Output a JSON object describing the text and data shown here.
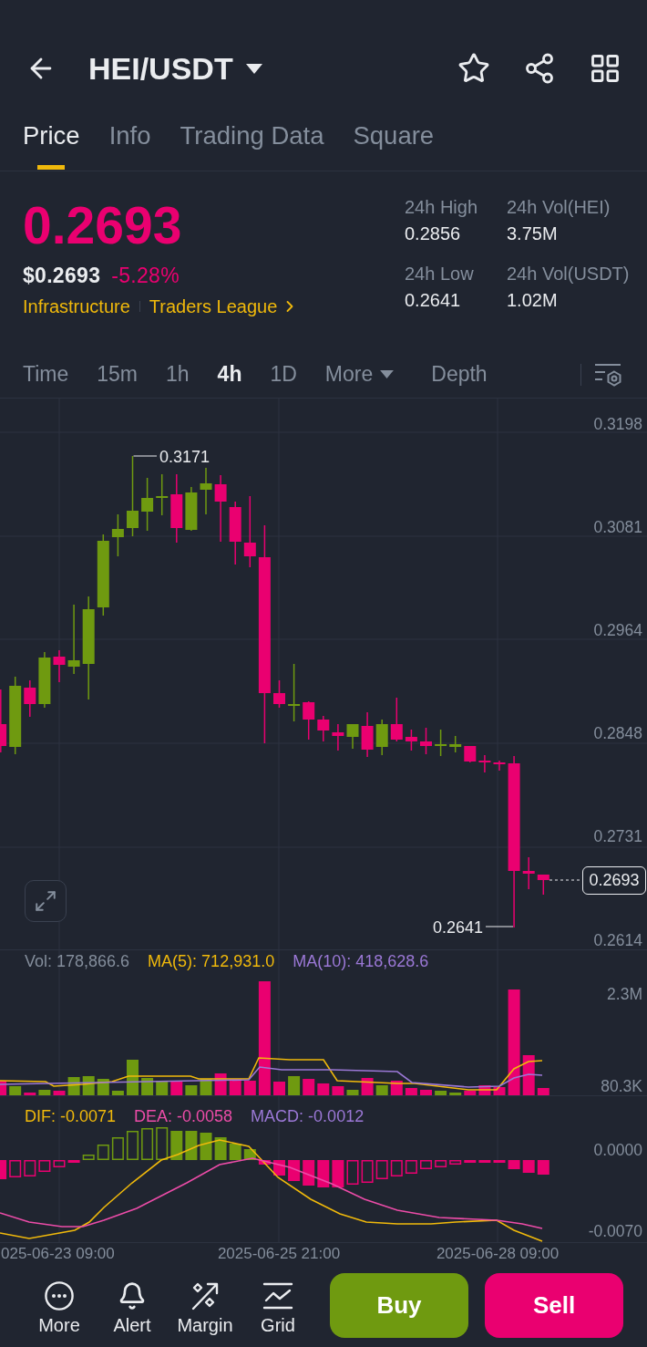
{
  "header": {
    "title": "HEI/USDT"
  },
  "tabs": [
    {
      "label": "Price",
      "selected": true
    },
    {
      "label": "Info",
      "selected": false
    },
    {
      "label": "Trading Data",
      "selected": false
    },
    {
      "label": "Square",
      "selected": false
    }
  ],
  "ticker": {
    "negative": true,
    "last": "0.2693",
    "fiat": "$0.2693",
    "change": "-5.28%",
    "tags": [
      {
        "label": "Infrastructure",
        "kind": "tag"
      },
      {
        "label": "Traders League",
        "kind": "link"
      }
    ]
  },
  "stats": [
    {
      "label": "24h High",
      "value": "0.2856"
    },
    {
      "label": "24h Vol(HEI)",
      "value": "3.75M"
    },
    {
      "label": "24h Low",
      "value": "0.2641"
    },
    {
      "label": "24h Vol(USDT)",
      "value": "1.02M"
    }
  ],
  "intervals": [
    {
      "label": "Time",
      "kind": "option",
      "selected": false
    },
    {
      "label": "15m",
      "kind": "option",
      "selected": false
    },
    {
      "label": "1h",
      "kind": "option",
      "selected": false
    },
    {
      "label": "4h",
      "kind": "option",
      "selected": true
    },
    {
      "label": "1D",
      "kind": "option",
      "selected": false
    },
    {
      "label": "More",
      "kind": "dropdown",
      "selected": false
    },
    {
      "label": "Depth",
      "kind": "option",
      "selected": false
    }
  ],
  "price_chart": {
    "axis_labels": [
      "0.3198",
      "0.3081",
      "0.2964",
      "0.2848",
      "0.2731",
      "0.2614"
    ],
    "high_label": "0.3171",
    "low_label": "0.2641",
    "last_price": "0.2693"
  },
  "volume_chart": {
    "legend": [
      {
        "label": "Vol: 178,866.6",
        "color": "#848e9c"
      },
      {
        "label": "MA(5): 712,931.0",
        "color": "#f0b90b"
      },
      {
        "label": "MA(10): 418,628.6",
        "color": "#9b78d6"
      }
    ],
    "axis_labels": [
      "2.3M",
      "80.3K"
    ]
  },
  "macd_chart": {
    "legend": [
      {
        "label": "DIF: -0.0071",
        "color": "#f0b90b"
      },
      {
        "label": "DEA: -0.0058",
        "color": "#ec4ca8"
      },
      {
        "label": "MACD: -0.0012",
        "color": "#9b78d6"
      }
    ],
    "axis_labels": [
      "0.0000",
      "-0.0070"
    ]
  },
  "time_axis": [
    "025-06-23 09:00",
    "2025-06-25 21:00",
    "2025-06-28 09:00"
  ],
  "bottom_bar": {
    "items": [
      {
        "label": "More"
      },
      {
        "label": "Alert"
      },
      {
        "label": "Margin"
      },
      {
        "label": "Grid"
      }
    ],
    "actions": [
      {
        "label": "Buy",
        "kind": "buy"
      },
      {
        "label": "Sell",
        "kind": "sell"
      }
    ]
  }
}
